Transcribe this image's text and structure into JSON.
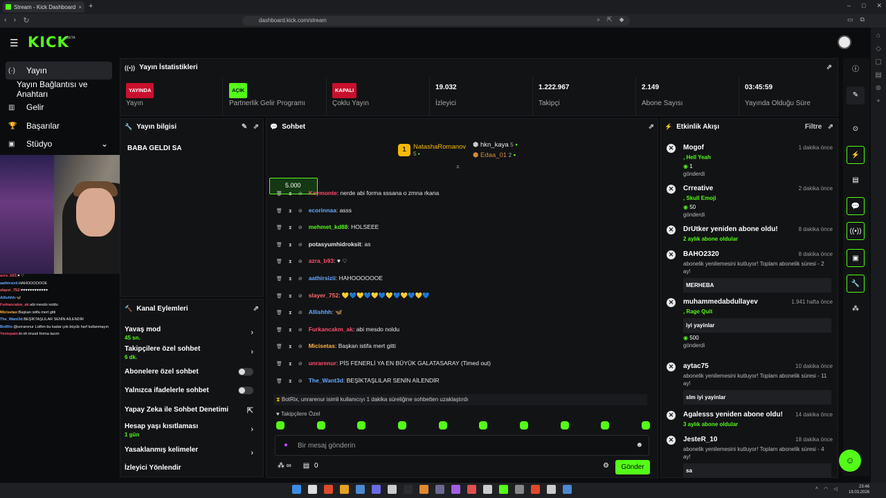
{
  "browser": {
    "tab_title": "Stream - Kick Dashboard",
    "url": "dashboard.kick.com/stream",
    "tab_close": "×",
    "new_tab": "+",
    "win_controls": [
      "–",
      "□",
      "✕"
    ],
    "nav": [
      "‹",
      "›",
      "↻"
    ]
  },
  "brand": {
    "logo": "KICK",
    "beta": "BETA",
    "accent": "#53fc18"
  },
  "sidebar": {
    "items": [
      {
        "label": "Yayın",
        "icon": "broadcast-icon",
        "glyph": "(·)"
      },
      {
        "label": "Yayın Bağlantısı ve Anahtarı"
      },
      {
        "label": "Gelir",
        "icon": "chart-icon",
        "glyph": "▥"
      },
      {
        "label": "Başarılar",
        "icon": "trophy-icon",
        "glyph": "🏆"
      },
      {
        "label": "Stüdyo",
        "icon": "studio-icon",
        "glyph": "▣",
        "chevron": "⌄"
      }
    ]
  },
  "overlay_chat": [
    {
      "u": "azra_b93:",
      "t": "♥ ♡",
      "c": "#ff4d6d"
    },
    {
      "u": "aathirsizii:",
      "t": "HAHOOOOOOE",
      "c": "#66aaff"
    },
    {
      "u": "slayer_752:",
      "t": "♥♥♥♥♥♥♥♥♥♥♥♥",
      "c": "#ff6b6b"
    },
    {
      "u": "Allishhh:",
      "t": "🦋",
      "c": "#66aaff"
    },
    {
      "u": "Furkancakm_ak:",
      "t": "abi mesdo noldu",
      "c": "#ff4d6d"
    },
    {
      "u": "Micisetas:",
      "t": "Başkan istifa mert gitti",
      "c": "#ffb347"
    },
    {
      "u": "The_Want3d:",
      "t": "BEŞİKTAŞLILAR SENİN AİLENDİR",
      "c": "#66aaff"
    },
    {
      "u": "BotRix:",
      "t": "@unrarenur Lütfen bu kadar çok büyük harf kullanmayın",
      "c": "#66aaff"
    },
    {
      "u": "Yenispain:",
      "t": "bi oh imzalı forma lazım",
      "c": "#ff4d6d"
    }
  ],
  "stats": {
    "title": "Yayın İstatistikleri",
    "items": [
      {
        "badge": "YAYINDA",
        "badge_color": "red",
        "label": "Yayın"
      },
      {
        "badge": "AÇIK",
        "badge_color": "green",
        "label": "Partnerlik Gelir Programı"
      },
      {
        "badge": "KAPALI",
        "badge_color": "red",
        "label": "Çoklu Yayın"
      },
      {
        "value": "19.032",
        "label": "İzleyici"
      },
      {
        "value": "1.222.967",
        "label": "Takipçi"
      },
      {
        "value": "2.149",
        "label": "Abone Sayısı"
      },
      {
        "value": "03:45:59",
        "label": "Yayında Olduğu Süre"
      }
    ]
  },
  "stream_info": {
    "title": "Yayın bilgisi",
    "stream_title": "BABA GELDI SA"
  },
  "channel_actions": {
    "title": "Kanal Eylemleri",
    "rows": [
      {
        "label": "Yavaş mod",
        "sub": "45 sn.",
        "ctrl": "arrow"
      },
      {
        "label": "Takipçilere özel sohbet",
        "sub": "6 dk.",
        "ctrl": "arrow"
      },
      {
        "label": "Abonelere özel sohbet",
        "sub": "",
        "ctrl": "toggle"
      },
      {
        "label": "Yalnızca ifadelerle sohbet",
        "sub": "",
        "ctrl": "toggle"
      },
      {
        "label": "Yapay Zeka ile Sohbet Denetimi",
        "sub": "",
        "ctrl": "link"
      },
      {
        "label": "Hesap yaşı kısıtlaması",
        "sub": "1 gün",
        "ctrl": "arrow"
      },
      {
        "label": "Yasaklanmış kelimeler",
        "sub": "",
        "ctrl": "arrow"
      },
      {
        "label": "İzleyici Yönlendir",
        "sub": "",
        "ctrl": "none"
      }
    ]
  },
  "chat": {
    "title": "Sohbet",
    "leaders": [
      {
        "rank": "1",
        "name": "NatashaRomanov",
        "count": "5"
      },
      {
        "name": "hkn_kaya",
        "count": "5"
      },
      {
        "name": "Edaa_01",
        "count": "2"
      }
    ],
    "goal": "5.000",
    "messages": [
      {
        "u": "Keymonte",
        "t": "nerde abi forma sssana o zmna rkana",
        "c": "#ff4d6d"
      },
      {
        "u": "ecorinnaa",
        "t": "asss",
        "c": "#66aaff"
      },
      {
        "u": "mehmet_kd88",
        "t": "HOLSEEE",
        "c": "#53fc18"
      },
      {
        "u": "potasyumhidroksit",
        "t": "as",
        "c": "#e8e8e8"
      },
      {
        "u": "azra_b93",
        "t": "♥ ♡",
        "c": "#ff4d6d"
      },
      {
        "u": "aathirsizii",
        "t": "HAHOOOOOOE",
        "c": "#66aaff"
      },
      {
        "u": "slayer_752",
        "t": "💛💙💛💙💛💙💛💙💛💙💛💙",
        "c": "#ff6b6b"
      },
      {
        "u": "Allishhh",
        "t": "🦋",
        "c": "#66aaff"
      },
      {
        "u": "Furkancakm_ak",
        "t": "abi mesdo noldu",
        "c": "#ff4d6d"
      },
      {
        "u": "Micisetas",
        "t": "Başkan istifa mert gitti",
        "c": "#ffb347"
      },
      {
        "u": "unrarenur",
        "t": "PİS FENERLİ YA EN BÜYÜK GALATASARAY (Timed out)",
        "c": "#ff4d6d"
      },
      {
        "u": "The_Want3d",
        "t": "BEŞİKTAŞLILAR SENİN AİLENDİR",
        "c": "#66aaff"
      }
    ],
    "system": "BotRix, unrarenur isimli kullanıcıyı 1 dakika süreliğine sohbetten uzaklaştırdı",
    "emote_label": "Takipçilere Özel",
    "placeholder": "Bir mesaj gönderin",
    "foot_count": "0",
    "send": "Gönder"
  },
  "activity": {
    "title": "Etkinlik Akışı",
    "filter": "Filtre",
    "items": [
      {
        "name": "Mogof",
        "time": "1 dakika önce",
        "line1": ", Hell Yeah",
        "amount": "1",
        "line3": "gönderdi"
      },
      {
        "name": "Crreative",
        "time": "2 dakika önce",
        "line1": ", Skull Emoji",
        "amount": "50",
        "line3": "gönderdi"
      },
      {
        "name": "DrUtker yeniden abone oldu!",
        "time": "8 dakika önce",
        "line1": "2 aylık abone oldular"
      },
      {
        "name": "BAHO2320",
        "time": "8 dakika önce",
        "line1": "abonelik yenilemesini kutluyor! Toplam abonelik süresi - 2 ay!",
        "box": "MERHEBA"
      },
      {
        "name": "muhammedabdullayev",
        "time": "1.941 hafta önce",
        "line1": ", Rage Quit",
        "box": "iyi yayinlar",
        "amount": "500",
        "line3": "gönderdi"
      },
      {
        "name": "aytac75",
        "time": "10 dakika önce",
        "line1": "abonelik yenilemesini kutluyor! Toplam abonelik süresi - 11 ay!",
        "box": "slm iyi yayinlar"
      },
      {
        "name": "Agalesss yeniden abone oldu!",
        "time": "14 dakika önce",
        "line1": "3 aylık abone oldular"
      },
      {
        "name": "JesteR_10",
        "time": "18 dakika önce",
        "line1": "abonelik yenilemesini kutluyor! Toplam abonelik süresi - 4 ay!",
        "box": "sa"
      }
    ]
  },
  "clock": {
    "time": "23:46",
    "date": "19.03.2026"
  }
}
